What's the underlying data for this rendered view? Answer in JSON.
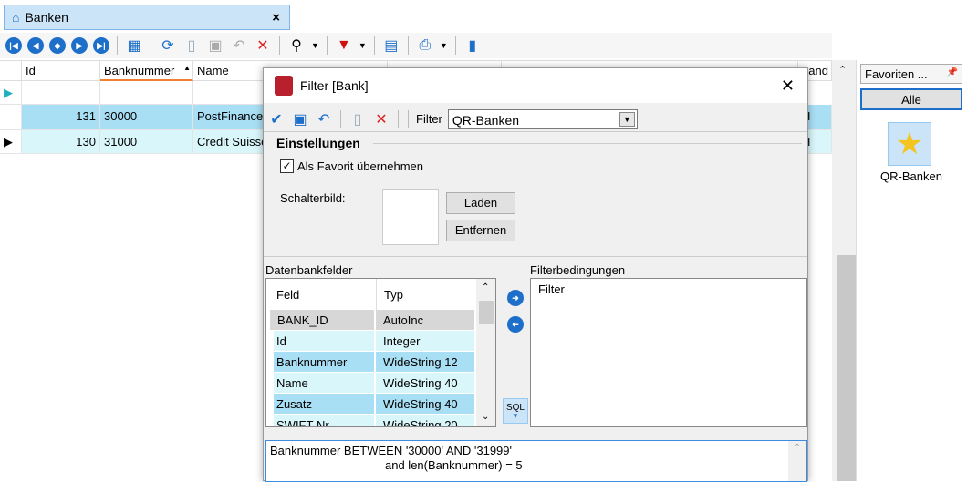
{
  "tab": {
    "title": "Banken",
    "close": "×",
    "icon": "bank-icon"
  },
  "toolbar": {
    "icons": [
      "first-icon",
      "prev-icon",
      "middle-icon",
      "next-icon",
      "last-icon",
      "view-icon",
      "refresh-icon",
      "new-icon",
      "save-icon",
      "undo-icon",
      "delete-icon",
      "pin-icon",
      "filter-icon",
      "export-icon",
      "print-icon",
      "exit-icon"
    ]
  },
  "grid": {
    "columns": [
      "Id",
      "Banknummer",
      "Name",
      "SWIFT-N",
      "St",
      "Land"
    ],
    "rows": [
      {
        "id": "131",
        "banknummer": "30000",
        "name": "PostFinance",
        "land": "H"
      },
      {
        "id": "130",
        "banknummer": "31000",
        "name": "Credit Suisse",
        "land": "H"
      }
    ]
  },
  "favorites": {
    "title": "Favoriten ...",
    "all": "Alle",
    "item": "QR-Banken",
    "pin": "📌"
  },
  "dialog": {
    "title": "Filter  [Bank]",
    "close": "✕",
    "filter_label": "Filter",
    "filter_value": "QR-Banken",
    "settings_title": "Einstellungen",
    "favorite_checkbox": "Als Favorit übernehmen",
    "favorite_checked": true,
    "button_image_label": "Schalterbild:",
    "load": "Laden",
    "remove": "Entfernen",
    "db_fields_label": "Datenbankfelder",
    "conditions_label": "Filterbedingungen",
    "field_header": "Feld",
    "type_header": "Typ",
    "fields": [
      {
        "f": "BANK_ID",
        "t": "AutoInc"
      },
      {
        "f": "Id",
        "t": "Integer"
      },
      {
        "f": "Banknummer",
        "t": "WideString 12"
      },
      {
        "f": "Name",
        "t": "WideString 40"
      },
      {
        "f": "Zusatz",
        "t": "WideString 40"
      },
      {
        "f": "SWIFT-Nr",
        "t": "WideString 20"
      }
    ],
    "conditions_root": "Filter",
    "sql_button": "SQL",
    "sql_line1": "Banknummer BETWEEN '30000' AND '31999'",
    "sql_line2": "and len(Banknummer) = 5"
  }
}
